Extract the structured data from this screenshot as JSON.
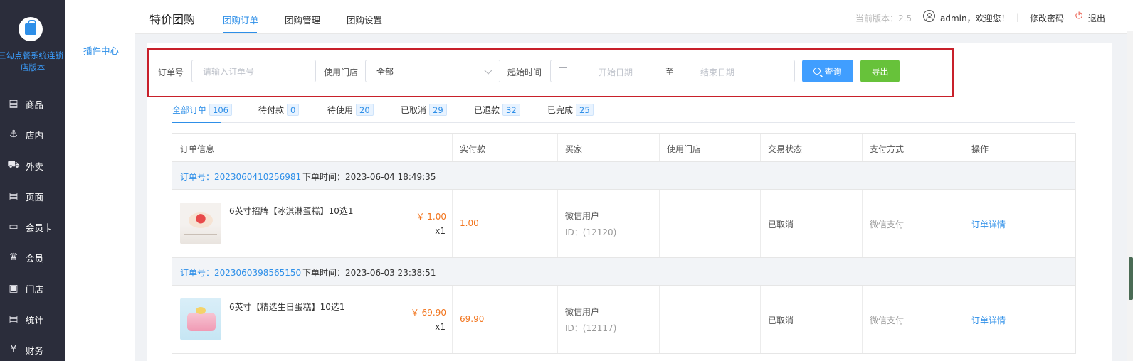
{
  "sidebar": {
    "brand_line1": "三勾点餐系统连锁",
    "brand_line2": "店版本",
    "items": [
      {
        "icon": "box-icon",
        "label": "商品"
      },
      {
        "icon": "utensils-icon",
        "label": "店内"
      },
      {
        "icon": "scooter-icon",
        "label": "外卖"
      },
      {
        "icon": "page-icon",
        "label": "页面"
      },
      {
        "icon": "card-icon",
        "label": "会员卡"
      },
      {
        "icon": "crown-icon",
        "label": "会员"
      },
      {
        "icon": "store-icon",
        "label": "门店"
      },
      {
        "icon": "chart-icon",
        "label": "统计"
      },
      {
        "icon": "yen-icon",
        "label": "财务"
      }
    ]
  },
  "sub_sidebar": {
    "item": "插件中心"
  },
  "header": {
    "title": "特价团购",
    "tabs": [
      "团购订单",
      "团购管理",
      "团购设置"
    ],
    "active_tab": "团购订单",
    "version": "当前版本：2.5",
    "user": "admin，欢迎您！",
    "separator": "|",
    "change_password": "修改密码",
    "logout": "退出"
  },
  "filters": {
    "order_no_label": "订单号",
    "order_no_placeholder": "请输入订单号",
    "store_label": "使用门店",
    "store_value": "全部",
    "time_label": "起始时间",
    "start_placeholder": "开始日期",
    "range_sep": "至",
    "end_placeholder": "结束日期",
    "search_button": "查询",
    "export_button": "导出"
  },
  "status_tabs": [
    {
      "label": "全部订单",
      "count": "106"
    },
    {
      "label": "待付款",
      "count": "0"
    },
    {
      "label": "待使用",
      "count": "20"
    },
    {
      "label": "已取消",
      "count": "29"
    },
    {
      "label": "已退款",
      "count": "32"
    },
    {
      "label": "已完成",
      "count": "25"
    }
  ],
  "table": {
    "columns": [
      "订单信息",
      "实付款",
      "买家",
      "使用门店",
      "交易状态",
      "支付方式",
      "操作"
    ],
    "orders": [
      {
        "order_no": "订单号：2023060410256981",
        "order_time": "下单时间：2023-06-04 18:49:35",
        "product": "6英寸招牌【冰淇淋蛋糕】10选1",
        "unit_price": "￥ 1.00",
        "qty": "x1",
        "paid": "1.00",
        "buyer": "微信用户",
        "buyer_id": "ID：(12120)",
        "store": "",
        "status": "已取消",
        "pay_method": "微信支付",
        "action": "订单详情"
      },
      {
        "order_no": "订单号：2023060398565150",
        "order_time": "下单时间：2023-06-03 23:38:51",
        "product": "6英寸【精选生日蛋糕】10选1",
        "unit_price": "￥ 69.90",
        "qty": "x1",
        "paid": "69.90",
        "buyer": "微信用户",
        "buyer_id": "ID：(12117)",
        "store": "",
        "status": "已取消",
        "pay_method": "微信支付",
        "action": "订单详情"
      }
    ]
  },
  "colors": {
    "accent": "#2e8fe8",
    "sidebar_bg": "#2b2d3b",
    "price": "#f2751e",
    "highlight_box": "#c8202a"
  }
}
